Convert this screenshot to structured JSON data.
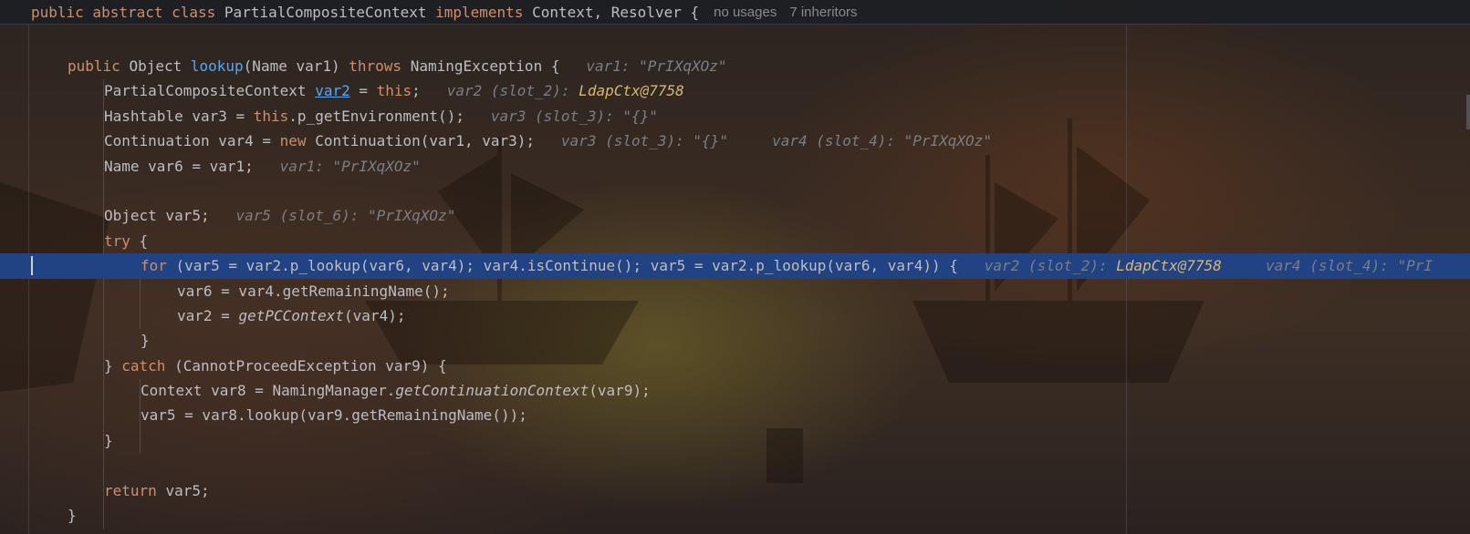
{
  "header": {
    "p1": "public abstract class ",
    "cls": "PartialCompositeContext ",
    "p2": "implements ",
    "p3": "Context, Resolver {",
    "usages": "no usages",
    "inheritors": "7 inheritors"
  },
  "code": {
    "l1": {
      "a": "public ",
      "b": "Object ",
      "c": "lookup",
      "d": "(Name var1) ",
      "e": "throws ",
      "f": "NamingException {",
      "hint": "var1: \"PrIXqXOz\""
    },
    "l2": {
      "a": "PartialCompositeContext ",
      "b": "var2",
      "c": " = ",
      "d": "this",
      "e": ";",
      "hint": "var2 (slot_2): ",
      "obj": "LdapCtx@7758"
    },
    "l3": {
      "a": "Hashtable var3 = ",
      "b": "this",
      "c": ".p_getEnvironment();",
      "hint": "var3 (slot_3): \"{}\""
    },
    "l4": {
      "a": "Continuation var4 = ",
      "b": "new ",
      "c": "Continuation(var1, var3);",
      "hint1": "var3 (slot_3): \"{}\"",
      "hint2": "var4 (slot_4): \"PrIXqXOz\""
    },
    "l5": {
      "a": "Name var6 = var1;",
      "hint": "var1: \"PrIXqXOz\""
    },
    "l7": {
      "a": "Object var5;",
      "hint": "var5 (slot_6): \"PrIXqXOz\""
    },
    "l8": {
      "a": "try ",
      "b": "{"
    },
    "l9": {
      "a": "for ",
      "b": "(var5 = var2.p_lookup(var6, var4); var4.isContinue(); var5 = var2.p_lookup(var6, var4)) {",
      "hint1": "var2 (slot_2): ",
      "obj": "LdapCtx@7758",
      "hint2": "var4 (slot_4): \"PrI"
    },
    "l10": {
      "a": "var6 = var4.getRemainingName();"
    },
    "l11": {
      "a": "var2 = ",
      "b": "getPCContext",
      "c": "(var4);"
    },
    "l12": {
      "a": "}"
    },
    "l13": {
      "a": "} ",
      "b": "catch ",
      "c": "(CannotProceedException var9) {"
    },
    "l14": {
      "a": "Context var8 = NamingManager.",
      "b": "getContinuationContext",
      "c": "(var9);"
    },
    "l15": {
      "a": "var5 = var8.lookup(var9.getRemainingName());"
    },
    "l16": {
      "a": "}"
    },
    "l18": {
      "a": "return ",
      "b": "var5;"
    },
    "l19": {
      "a": "}"
    }
  },
  "colors": {
    "keyword": "#cf8e6d",
    "method": "#56a8f5",
    "inlay_hint": "#7a7e85",
    "object_ref": "#d5b778",
    "execution_line": "#214283"
  }
}
